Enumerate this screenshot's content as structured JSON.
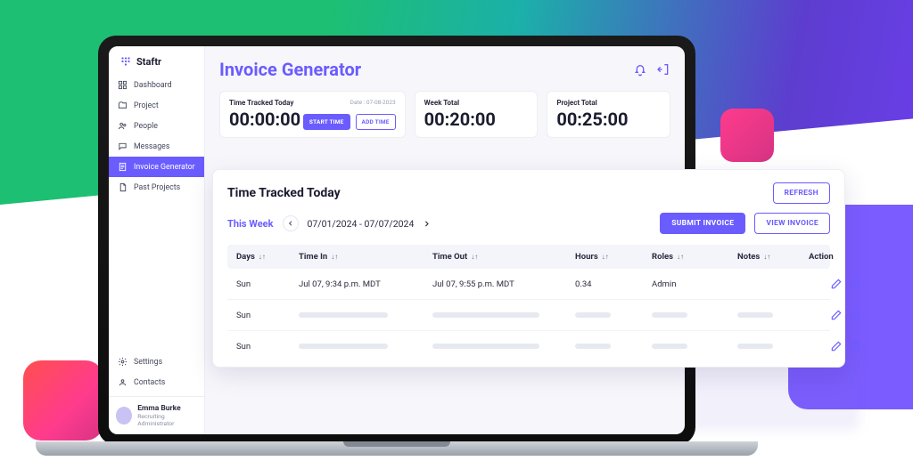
{
  "brand": "Staftr",
  "header": {
    "title": "Invoice Generator"
  },
  "sidebar": {
    "items": [
      {
        "label": "Dashboard"
      },
      {
        "label": "Project"
      },
      {
        "label": "People"
      },
      {
        "label": "Messages"
      },
      {
        "label": "Invoice Generator"
      },
      {
        "label": "Past Projects"
      }
    ],
    "bottom": [
      {
        "label": "Settings"
      },
      {
        "label": "Contacts"
      }
    ]
  },
  "user": {
    "name": "Emma Burke",
    "role": "Recruiting Administrator"
  },
  "stats": {
    "today": {
      "label": "Time Tracked Today",
      "value": "00:00:00",
      "date": "Date : 07-08-2023",
      "start": "START TIME",
      "add": "ADD TIME"
    },
    "week": {
      "label": "Week Total",
      "value": "00:20:00"
    },
    "project": {
      "label": "Project Total",
      "value": "00:25:00"
    }
  },
  "panel": {
    "title": "Time Tracked Today",
    "refresh": "REFRESH",
    "range_label": "This Week",
    "range_text": "07/01/2024 - 07/07/2024",
    "submit": "SUBMIT INVOICE",
    "view": "VIEW INVOICE",
    "cols": {
      "days": "Days",
      "timein": "Time In",
      "timeout": "Time Out",
      "hours": "Hours",
      "roles": "Roles",
      "notes": "Notes",
      "action": "Action"
    },
    "rows": [
      {
        "day": "Sun",
        "timein": "Jul 07, 9:34 p.m. MDT",
        "timeout": "Jul 07, 9:55 p.m. MDT",
        "hours": "0.34",
        "roles": "Admin"
      },
      {
        "day": "Sun"
      },
      {
        "day": "Sun"
      }
    ]
  }
}
